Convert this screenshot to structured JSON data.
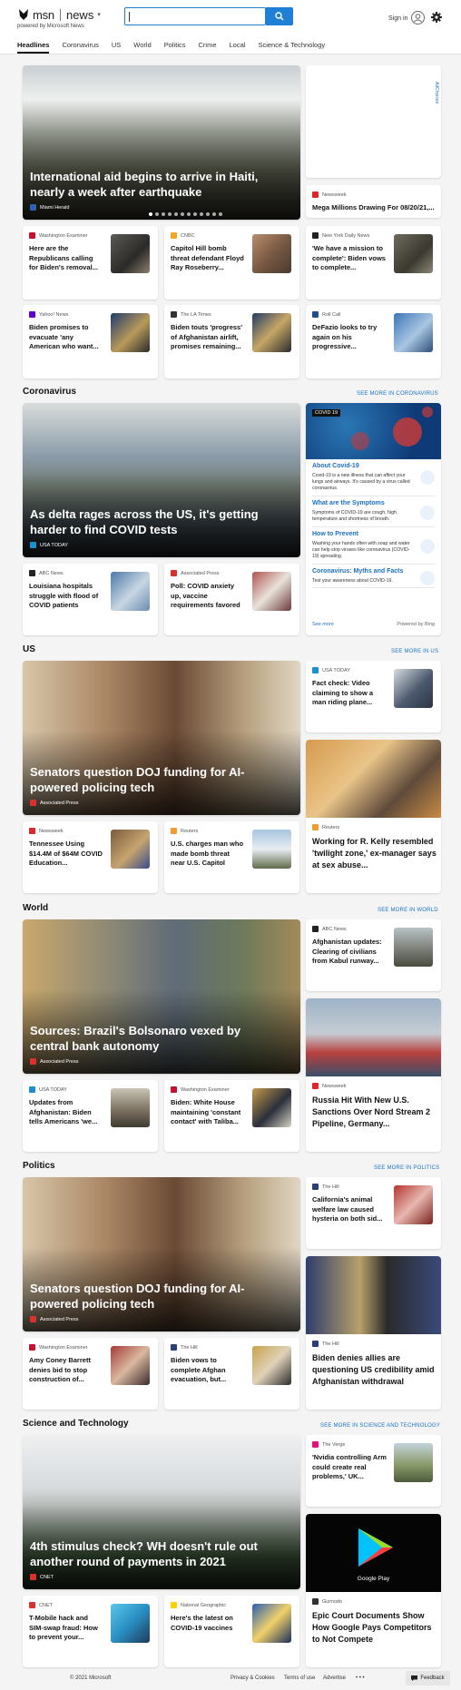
{
  "header": {
    "brand": "msn",
    "section": "news",
    "powered_by": "powered by Microsoft News",
    "search_placeholder": "",
    "sign_in": "Sign in"
  },
  "nav": [
    "Headlines",
    "Coronavirus",
    "US",
    "World",
    "Politics",
    "Crime",
    "Local",
    "Science & Technology"
  ],
  "top": {
    "hero": {
      "title": "International aid begins to arrive in Haiti, nearly a week after earthquake",
      "source": "Miami Herald"
    },
    "ad": {
      "label": "AdChoices",
      "source": "Newsweek",
      "title": "Mega Millions Drawing For 08/20/21,..."
    },
    "cards": [
      {
        "source": "Washington Examiner",
        "title": "Here are the Republicans calling for Biden's removal..."
      },
      {
        "source": "CNBC",
        "title": "Capitol Hill bomb threat defendant Floyd Ray Roseberry..."
      },
      {
        "source": "New York Daily News",
        "title": "'We have a mission to complete': Biden vows to complete..."
      },
      {
        "source": "Yahoo! News",
        "title": "Biden promises to evacuate 'any American who want..."
      },
      {
        "source": "The LA Times",
        "title": "Biden touts 'progress' of Afghanistan airlift, promises remaining..."
      },
      {
        "source": "Roll Call",
        "title": "DeFazio looks to try again on his progressive..."
      }
    ]
  },
  "coronavirus": {
    "heading": "Coronavirus",
    "more": "SEE MORE IN CORONAVIRUS",
    "hero": {
      "title": "As delta rages across the US, it's getting harder to find COVID tests",
      "source": "USA TODAY"
    },
    "cards": [
      {
        "source": "ABC News",
        "title": "Louisiana hospitals struggle with flood of COVID patients"
      },
      {
        "source": "Associated Press",
        "title": "Poll: COVID anxiety up, vaccine requirements favored"
      }
    ],
    "widget": {
      "tag": "COVID 19",
      "items": [
        {
          "h": "About Covid-19",
          "d": "Covid-19 is a new illness that can affect your lungs and airways. It's caused by a virus called coronavirus."
        },
        {
          "h": "What are the Symptoms",
          "d": "Symptoms of COVID-19 are cough, high temperature and shortness of breath."
        },
        {
          "h": "How to Prevent",
          "d": "Washing your hands often with soap and water can help stop viruses like coronavirus (COVID-19) spreading."
        },
        {
          "h": "Coronavirus: Myths and Facts",
          "d": "Test your awareness about COVID-19."
        }
      ],
      "see_more": "See more",
      "powered": "Powered by Bing"
    }
  },
  "us": {
    "heading": "US",
    "more": "SEE MORE IN US",
    "hero": {
      "title": "Senators question DOJ funding for AI-powered policing tech",
      "source": "Associated Press"
    },
    "side_top": {
      "source": "USA TODAY",
      "title": "Fact check: Video claiming to show a man riding plane..."
    },
    "side_big": {
      "source": "Reuters",
      "title": "Working for R. Kelly resembled 'twilight zone,' ex-manager says at sex abuse..."
    },
    "cards": [
      {
        "source": "Newsweek",
        "title": "Tennessee Using $14.4M of $64M COVID Education..."
      },
      {
        "source": "Reuters",
        "title": "U.S. charges man who made bomb threat near U.S. Capitol"
      }
    ]
  },
  "world": {
    "heading": "World",
    "more": "SEE MORE IN WORLD",
    "hero": {
      "title": "Sources: Brazil's Bolsonaro vexed by central bank autonomy",
      "source": "Associated Press"
    },
    "side_top": {
      "source": "ABC News",
      "title": "Afghanistan updates: Clearing of civilians from Kabul runway..."
    },
    "side_big": {
      "source": "Newsweek",
      "title": "Russia Hit With New U.S. Sanctions Over Nord Stream 2 Pipeline, Germany..."
    },
    "cards": [
      {
        "source": "USA TODAY",
        "title": "Updates from Afghanistan: Biden tells Americans 'we..."
      },
      {
        "source": "Washington Examiner",
        "title": "Biden: White House maintaining 'constant contact' with Taliba..."
      }
    ]
  },
  "politics": {
    "heading": "Politics",
    "more": "SEE MORE IN POLITICS",
    "hero": {
      "title": "Senators question DOJ funding for AI-powered policing tech",
      "source": "Associated Press"
    },
    "side_top": {
      "source": "The Hill",
      "title": "California's animal welfare law caused hysteria on both sid..."
    },
    "side_big": {
      "source": "The Hill",
      "title": "Biden denies allies are questioning US credibility amid Afghanistan withdrawal"
    },
    "cards": [
      {
        "source": "Washington Examiner",
        "title": "Amy Coney Barrett denies bid to stop construction of..."
      },
      {
        "source": "The Hill",
        "title": "Biden vows to complete Afghan evacuation, but..."
      }
    ]
  },
  "scitech": {
    "heading": "Science and Technology",
    "more": "SEE MORE IN SCIENCE AND TECHNOLOGY",
    "hero": {
      "title": "4th stimulus check? WH doesn't rule out another round of payments in 2021",
      "source": "CNET"
    },
    "side_top": {
      "source": "The Verge",
      "title": "'Nvidia controlling Arm could create real problems,' UK..."
    },
    "side_big": {
      "source": "Gizmodo",
      "title": "Epic Court Documents Show How Google Pays Competitors to Not Compete",
      "img_text": "Google Play"
    },
    "cards": [
      {
        "source": "CNET",
        "title": "T-Mobile hack and SIM-swap fraud: How to prevent your..."
      },
      {
        "source": "National Geographic",
        "title": "Here's the latest on COVID-19 vaccines"
      }
    ]
  },
  "footer": {
    "copyright": "© 2021 Microsoft",
    "privacy": "Privacy & Cookies",
    "terms": "Terms of use",
    "advertise": "Advertise",
    "more": "• • •",
    "feedback": "Feedback"
  },
  "colors": {
    "accent": "#1f7fd4",
    "link": "#1a73c8"
  }
}
